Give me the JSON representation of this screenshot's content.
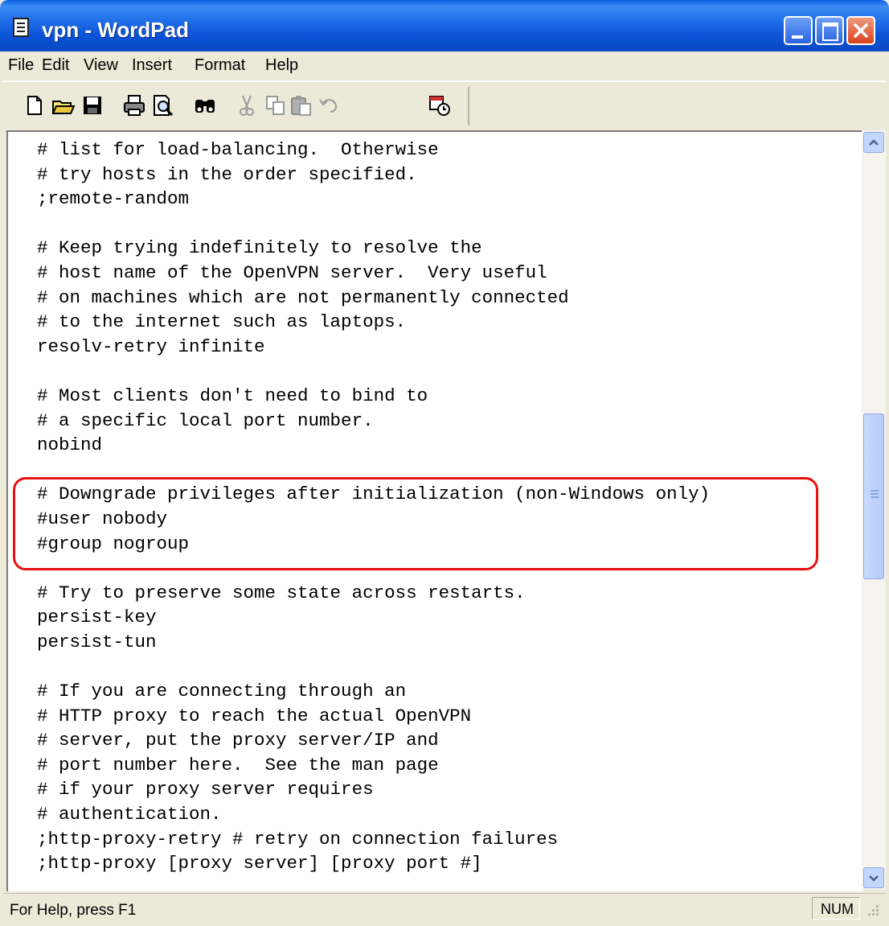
{
  "window": {
    "title": "vpn - WordPad"
  },
  "menubar": {
    "items": [
      "File",
      "Edit",
      "View",
      "Insert",
      "Format",
      "Help"
    ]
  },
  "toolbar": {
    "icons": [
      "new-document-icon",
      "open-folder-icon",
      "save-disk-icon",
      "print-icon",
      "print-preview-icon",
      "find-binoculars-icon",
      "cut-scissors-icon",
      "copy-icon",
      "paste-icon",
      "undo-icon",
      "date-time-icon"
    ]
  },
  "document": {
    "lines": [
      "# list for load-balancing.  Otherwise",
      "# try hosts in the order specified.",
      ";remote-random",
      "",
      "# Keep trying indefinitely to resolve the",
      "# host name of the OpenVPN server.  Very useful",
      "# on machines which are not permanently connected",
      "# to the internet such as laptops.",
      "resolv-retry infinite",
      "",
      "# Most clients don't need to bind to",
      "# a specific local port number.",
      "nobind",
      "",
      "# Downgrade privileges after initialization (non-Windows only)",
      "#user nobody",
      "#group nogroup",
      "",
      "# Try to preserve some state across restarts.",
      "persist-key",
      "persist-tun",
      "",
      "# If you are connecting through an",
      "# HTTP proxy to reach the actual OpenVPN",
      "# server, put the proxy server/IP and",
      "# port number here.  See the man page",
      "# if your proxy server requires",
      "# authentication.",
      ";http-proxy-retry # retry on connection failures",
      ";http-proxy [proxy server] [proxy port #]"
    ],
    "highlight_color": "#e81010"
  },
  "statusbar": {
    "help_text": "For Help, press F1",
    "num_indicator": "NUM"
  }
}
